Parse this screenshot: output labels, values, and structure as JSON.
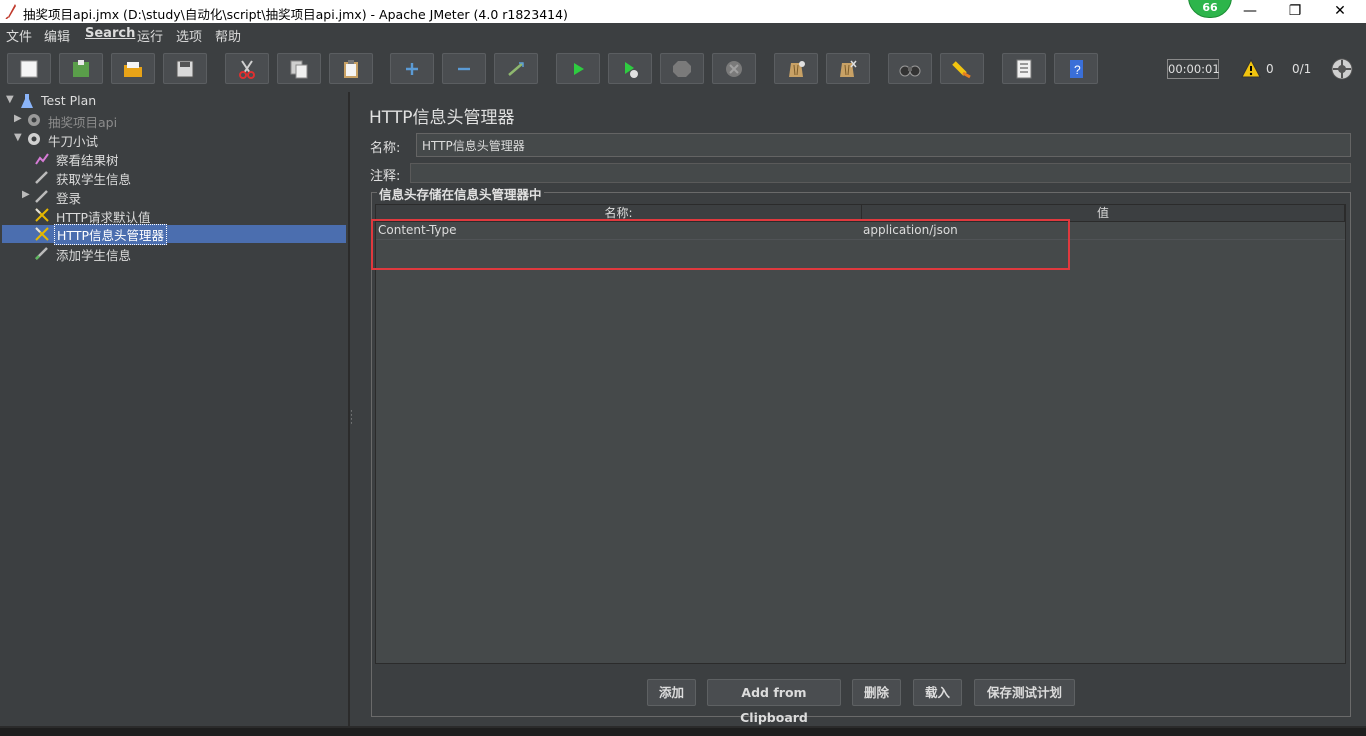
{
  "window": {
    "title": "抽奖项目api.jmx (D:\\study\\自动化\\script\\抽奖项目api.jmx) - Apache JMeter (4.0 r1823414)",
    "badge": "66",
    "minimize": "—",
    "restore": "❐",
    "close": "✕"
  },
  "menu": {
    "file": "文件",
    "edit": "编辑",
    "search": "Search",
    "run": "运行",
    "options": "选项",
    "help": "帮助"
  },
  "toolbar": {
    "timer": "00:00:01",
    "warnings": "0",
    "threads": "0/1"
  },
  "tree": {
    "root": "Test Plan",
    "items": [
      {
        "label": "抽奖项目api"
      },
      {
        "label": "牛刀小试"
      },
      {
        "label": "察看结果树"
      },
      {
        "label": "获取学生信息"
      },
      {
        "label": "登录"
      },
      {
        "label": "HTTP请求默认值"
      },
      {
        "label": "HTTP信息头管理器"
      },
      {
        "label": "添加学生信息"
      }
    ]
  },
  "panel": {
    "title": "HTTP信息头管理器",
    "name_label": "名称:",
    "name_value": "HTTP信息头管理器",
    "comment_label": "注释:",
    "group_title": "信息头存储在信息头管理器中",
    "columns": [
      "名称:",
      "值"
    ],
    "rows": [
      {
        "name": "Content-Type",
        "value": "application/json"
      }
    ],
    "buttons": {
      "add": "添加",
      "add_clipboard": "Add from Clipboard",
      "delete": "删除",
      "load": "载入",
      "save": "保存测试计划"
    }
  },
  "colors": {
    "background": "#3c3f41",
    "selection": "#4b6eaf",
    "highlight_box": "#e0393e",
    "badge": "#2db54b"
  }
}
